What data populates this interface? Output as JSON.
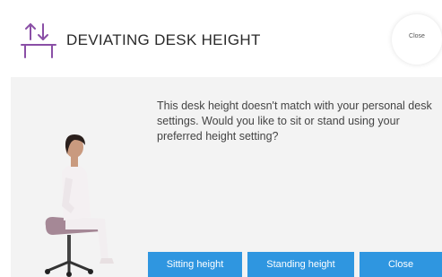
{
  "dialog": {
    "title": "DEVIATING DESK HEIGHT",
    "close_small_label": "Close",
    "message": "This desk height doesn't match with your personal desk settings. Would you like to sit or stand using your preferred height setting?",
    "icon": "desk-height-icon",
    "accent_color": "#8a4fa6",
    "button_color": "#2f96e0"
  },
  "buttons": {
    "sitting": "Sitting height",
    "standing": "Standing height",
    "close": "Close"
  }
}
